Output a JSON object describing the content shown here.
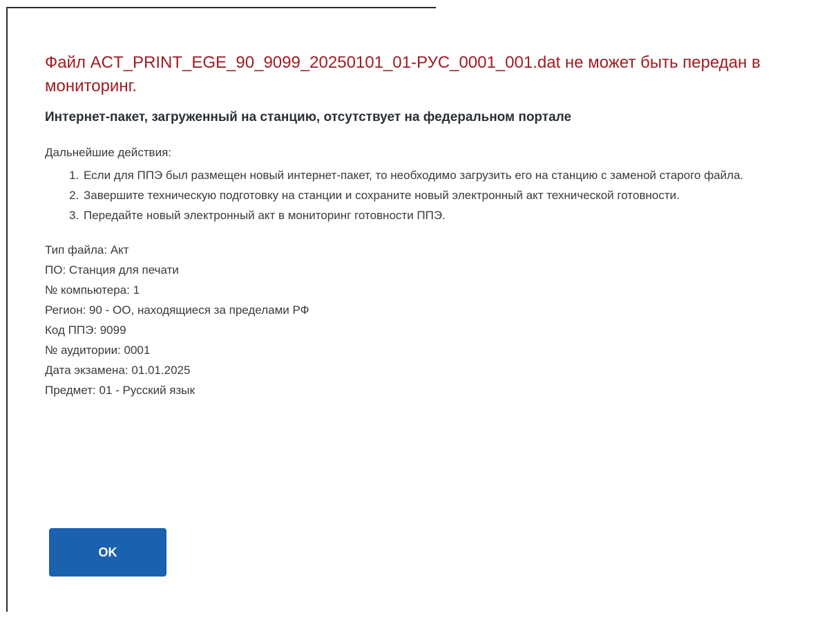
{
  "dialog": {
    "title": "Файл ACT_PRINT_EGE_90_9099_20250101_01-РУС_0001_001.dat не может быть передан в мониторинг.",
    "subtitle": "Интернет-пакет, загруженный на станцию, отсутствует на федеральном портале",
    "next_steps_label": "Дальнейшие действия:",
    "steps": [
      "Если для ППЭ был размещен новый интернет-пакет, то необходимо загрузить его на станцию с заменой старого файла.",
      "Завершите техническую подготовку на станции и сохраните новый электронный акт технической готовности.",
      "Передайте новый электронный акт в мониторинг готовности ППЭ."
    ],
    "info": [
      "Тип файла: Акт",
      "ПО: Станция для печати",
      "№ компьютера: 1",
      "Регион: 90 - ОО, находящиеся за пределами РФ",
      "Код ППЭ: 9099",
      "№ аудитории: 0001",
      "Дата экзамена: 01.01.2025",
      "Предмет: 01 - Русский язык"
    ],
    "ok_label": "OK"
  },
  "colors": {
    "title": "#a11b22",
    "button": "#1a62b0"
  }
}
